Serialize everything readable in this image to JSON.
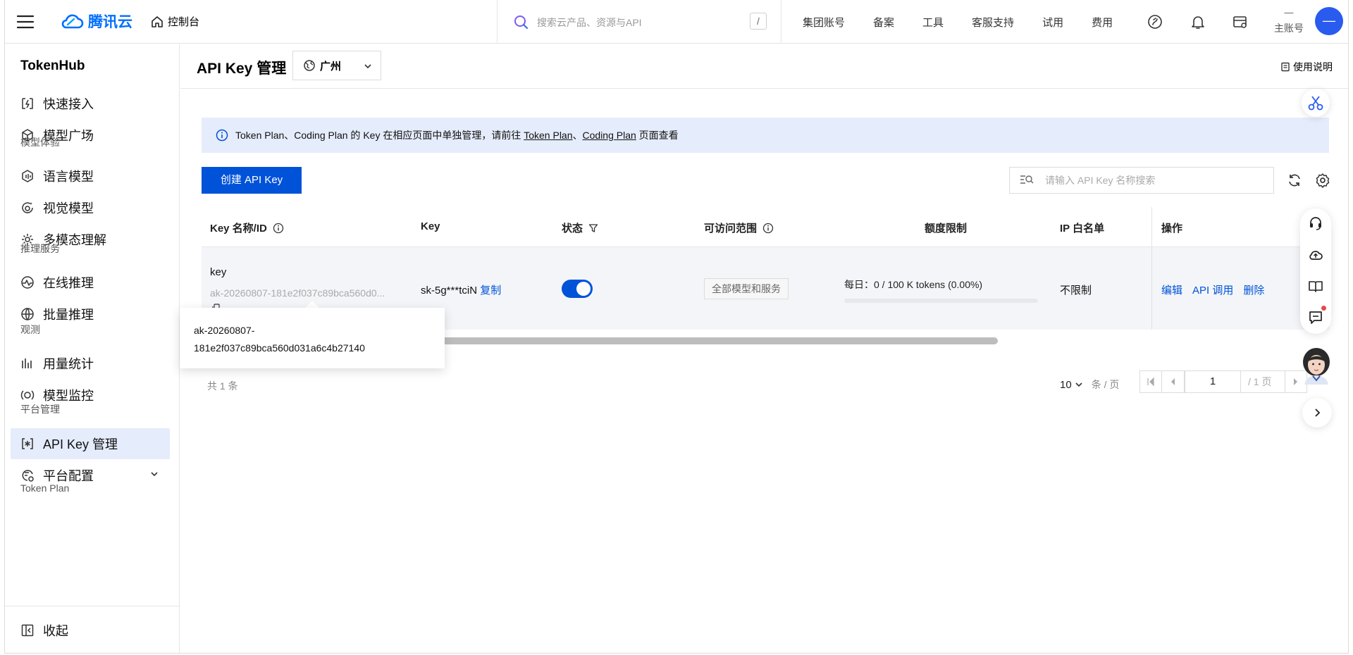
{
  "topbar": {
    "logo_text": "腾讯云",
    "console_label": "控制台",
    "search_placeholder": "搜索云产品、资源与API",
    "search_shortcut": "/",
    "nav": [
      "集团账号",
      "备案",
      "工具",
      "客服支持",
      "试用",
      "费用"
    ],
    "account_dash": "—",
    "account_label": "主账号",
    "avatar_text": "—",
    "icons": [
      "menu-icon",
      "cloud-logo-icon",
      "home-icon",
      "search-icon",
      "app-icon",
      "bell-icon",
      "order-icon"
    ]
  },
  "sidebar": {
    "title": "TokenHub",
    "items": [
      {
        "label": "快速接入",
        "icon": "quick-access-icon"
      },
      {
        "label": "模型广场",
        "icon": "cube-icon"
      },
      {
        "label": "语言模型",
        "icon": "language-model-icon"
      },
      {
        "label": "视觉模型",
        "icon": "vision-model-icon"
      },
      {
        "label": "多模态理解",
        "icon": "multimodal-icon"
      },
      {
        "label": "在线推理",
        "icon": "online-inference-icon"
      },
      {
        "label": "批量推理",
        "icon": "batch-inference-icon"
      },
      {
        "label": "用量统计",
        "icon": "usage-chart-icon"
      },
      {
        "label": "模型监控",
        "icon": "monitor-icon"
      },
      {
        "label": "API Key 管理",
        "icon": "api-key-icon"
      },
      {
        "label": "平台配置",
        "icon": "platform-config-icon"
      }
    ],
    "groups": [
      "模型体验",
      "推理服务",
      "观测",
      "平台管理",
      "Token Plan"
    ],
    "collapse_label": "收起",
    "active": "API Key 管理"
  },
  "header": {
    "title": "API Key 管理",
    "region": "广州",
    "help_label": "使用说明"
  },
  "notice": {
    "prefix": "Token Plan、Coding Plan 的 Key 在相应页面中单独管理，请前往 ",
    "link1": "Token Plan",
    "sep": "、",
    "link2": "Coding Plan",
    "suffix": " 页面查看"
  },
  "toolbar": {
    "create_label": "创建 API Key",
    "search_placeholder": "请输入 API Key 名称搜索"
  },
  "table": {
    "headers": {
      "name": "Key 名称/ID",
      "key": "Key",
      "status": "状态",
      "scope": "可访问范围",
      "quota": "额度限制",
      "ip": "IP 白名单",
      "ops": "操作"
    },
    "rows": [
      {
        "name": "key",
        "id": "ak-20260807-181e2f037c89bca560d0...",
        "key": "sk-5g***tciN",
        "copy_label": "复制",
        "status_on": true,
        "scope": "全部模型和服务",
        "quota": "每日：0 / 100 K tokens (0.00%)",
        "quota_fraction": 0,
        "ip": "不限制",
        "ops": [
          "编辑",
          "API 调用",
          "删除"
        ]
      }
    ]
  },
  "tooltip": {
    "line1": "ak-20260807-",
    "line2": "181e2f037c89bca560d031a6c4b27140"
  },
  "pagination": {
    "total": "共 1 条",
    "page_size": "10",
    "page_size_unit": "条 / 页",
    "current_page": "1",
    "total_pages": "/ 1 页"
  },
  "colors": {
    "brand": "#006eff",
    "primary": "#0052d9",
    "active_bg": "#e5ecfb",
    "notice_bg": "#e5ecfb"
  }
}
